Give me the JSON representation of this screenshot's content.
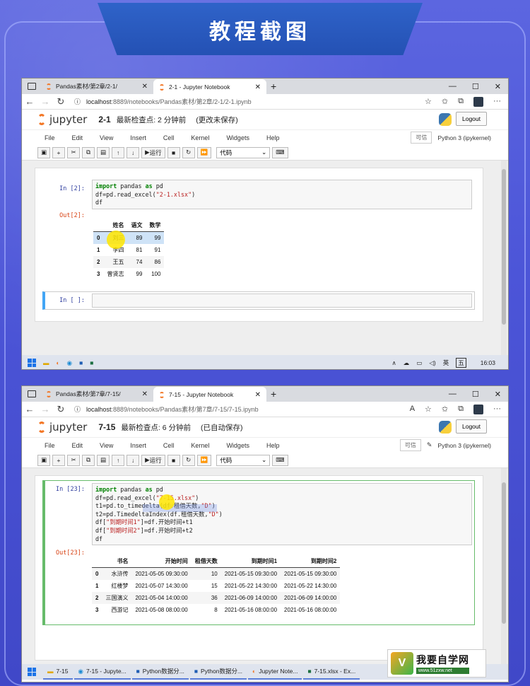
{
  "header": {
    "title": "教程截图"
  },
  "shot1": {
    "tabs": [
      "Pandas素材/第2章/2-1/",
      "2-1 - Jupyter Notebook"
    ],
    "url_host": "localhost",
    "url_path": ":8889/notebooks/Pandas素材/第2章/2-1/2-1.ipynb",
    "nb_name": "2-1",
    "checkpoint": "最新检查点: 2 分钟前",
    "save_status": "(更改未保存)",
    "logout": "Logout",
    "menu": [
      "File",
      "Edit",
      "View",
      "Insert",
      "Cell",
      "Kernel",
      "Widgets",
      "Help"
    ],
    "trusted": "可信",
    "kernel": "Python 3 (ipykernel)",
    "run_label": "运行",
    "cell_type": "代码",
    "in_prompt": "In [2]:",
    "out_prompt": "Out[2]:",
    "code": [
      "import pandas as pd",
      "df=pd.read_excel(\"2-1.xlsx\")",
      "df"
    ],
    "table": {
      "columns": [
        "",
        "姓名",
        "语文",
        "数学"
      ],
      "rows": [
        [
          "0",
          "刘三",
          "89",
          "99"
        ],
        [
          "1",
          "李四",
          "81",
          "91"
        ],
        [
          "2",
          "王五",
          "74",
          "86"
        ],
        [
          "3",
          "曾贤志",
          "99",
          "100"
        ]
      ]
    },
    "empty_prompt": "In [ ]:",
    "taskbar_clock": "16:03",
    "taskbar_lang": "英",
    "taskbar_day": "五"
  },
  "shot2": {
    "tabs": [
      "Pandas素材/第7章/7-15/",
      "7-15 - Jupyter Notebook"
    ],
    "url_host": "localhost",
    "url_path": ":8889/notebooks/Pandas素材/第7章/7-15/7-15.ipynb",
    "nb_name": "7-15",
    "checkpoint": "最新检查点: 6 分钟前",
    "save_status": "(已自动保存)",
    "logout": "Logout",
    "menu": [
      "File",
      "Edit",
      "View",
      "Insert",
      "Cell",
      "Kernel",
      "Widgets",
      "Help"
    ],
    "trusted": "可信",
    "kernel": "Python 3 (ipykernel)",
    "run_label": "运行",
    "cell_type": "代码",
    "in_prompt": "In [23]:",
    "out_prompt": "Out[23]:",
    "code": [
      "import pandas as pd",
      "df=pd.read_excel(\"7-15.xlsx\")",
      "t1=pd.to_timedelta(df.租借天数,\"D\")",
      "t2=pd.TimedeltaIndex(df.租借天数,\"D\")",
      "df[\"到期时间1\"]=df.开始时间+t1",
      "df[\"到期时间2\"]=df.开始时间+t2",
      "df"
    ],
    "table": {
      "columns": [
        "",
        "书名",
        "开始时间",
        "租借天数",
        "到期时间1",
        "到期时间2"
      ],
      "rows": [
        [
          "0",
          "水浒传",
          "2021-05-05 09:30:00",
          "10",
          "2021-05-15 09:30:00",
          "2021-05-15 09:30:00"
        ],
        [
          "1",
          "红楼梦",
          "2021-05-07 14:30:00",
          "15",
          "2021-05-22 14:30:00",
          "2021-05-22 14:30:00"
        ],
        [
          "2",
          "三国演义",
          "2021-05-04 14:00:00",
          "36",
          "2021-06-09 14:00:00",
          "2021-06-09 14:00:00"
        ],
        [
          "3",
          "西游记",
          "2021-05-08 08:00:00",
          "8",
          "2021-05-16 08:00:00",
          "2021-05-16 08:00:00"
        ]
      ]
    },
    "taskbar_items": [
      "7-15",
      "7-15 - Jupyte...",
      "Python数据分...",
      "Python数据分...",
      "Jupyter Note...",
      "7-15.xlsx - Ex..."
    ]
  },
  "watermark": {
    "name": "我要自学网",
    "url": "www.51zxw.net"
  }
}
